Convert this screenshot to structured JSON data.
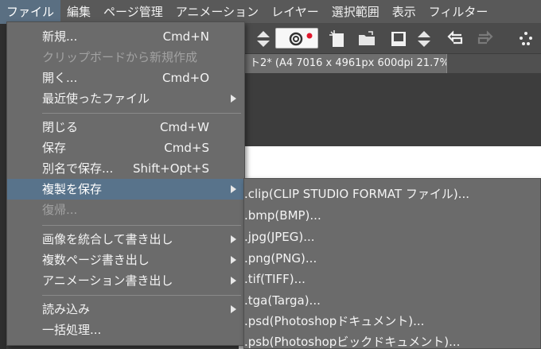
{
  "menubar": {
    "items": [
      "ファイル",
      "編集",
      "ページ管理",
      "アニメーション",
      "レイヤー",
      "選択範囲",
      "表示",
      "フィルター"
    ]
  },
  "document": {
    "tab_title": "ト2* (A4 7016 x 4961px 600dpi 21.7%)"
  },
  "file_menu": {
    "items": [
      {
        "label": "新規...",
        "shortcut": "Cmd+N"
      },
      {
        "label": "クリップボードから新規作成",
        "shortcut": ""
      },
      {
        "label": "開く...",
        "shortcut": "Cmd+O"
      },
      {
        "label": "最近使ったファイル",
        "shortcut": ""
      },
      {
        "label": "閉じる",
        "shortcut": "Cmd+W"
      },
      {
        "label": "保存",
        "shortcut": "Cmd+S"
      },
      {
        "label": "別名で保存...",
        "shortcut": "Shift+Opt+S"
      },
      {
        "label": "複製を保存",
        "shortcut": ""
      },
      {
        "label": "復帰...",
        "shortcut": ""
      },
      {
        "label": "画像を統合して書き出し",
        "shortcut": ""
      },
      {
        "label": "複数ページ書き出し",
        "shortcut": ""
      },
      {
        "label": "アニメーション書き出し",
        "shortcut": ""
      },
      {
        "label": "読み込み",
        "shortcut": ""
      },
      {
        "label": "一括処理...",
        "shortcut": ""
      }
    ]
  },
  "save_copy_submenu": {
    "items": [
      ".clip(CLIP STUDIO FORMAT ファイル)...",
      ".bmp(BMP)...",
      ".jpg(JPEG)...",
      ".png(PNG)...",
      ".tif(TIFF)...",
      ".tga(Targa)...",
      ".psd(Photoshopドキュメント)...",
      ".psb(Photoshopビックドキュメント)..."
    ]
  },
  "colors": {
    "menu_bg": "#6b6b6b",
    "highlight": "#58738b",
    "menubar_bg": "#595959"
  }
}
